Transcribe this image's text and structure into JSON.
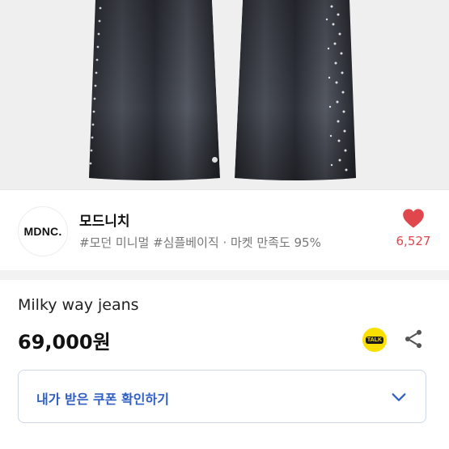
{
  "product_image": {
    "alt": "product-photo",
    "carousel_dots": 2
  },
  "shop": {
    "logo_text": "MDNC.",
    "name": "모드니치",
    "tags": "#모던 미니멀 #심플베이직 · 마켓 만족도 95%",
    "like_count": "6,527"
  },
  "product": {
    "title": "Milky way jeans",
    "price": "69,000원"
  },
  "actions": {
    "talk_label": "TALK"
  },
  "coupon": {
    "label": "내가 받은 쿠폰 확인하기"
  },
  "colors": {
    "like": "#e0474d",
    "coupon_text": "#2f5ec4",
    "talk_bg": "#f9e000"
  }
}
